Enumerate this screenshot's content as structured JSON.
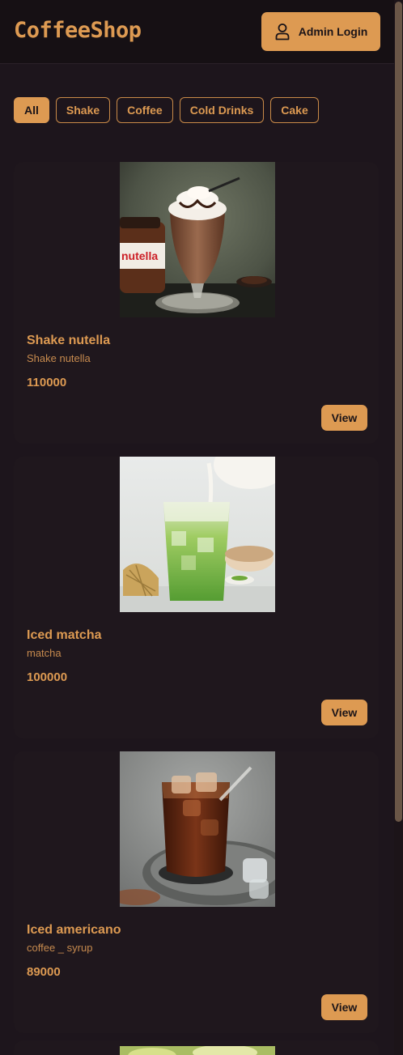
{
  "header": {
    "logo": "CoffeeShop",
    "admin_button": "Admin Login",
    "admin_icon": "user-icon"
  },
  "filters": [
    {
      "label": "All",
      "active": true
    },
    {
      "label": "Shake",
      "active": false
    },
    {
      "label": "Coffee",
      "active": false
    },
    {
      "label": "Cold Drinks",
      "active": false
    },
    {
      "label": "Cake",
      "active": false
    }
  ],
  "products": [
    {
      "name": "Shake nutella",
      "description": "Shake nutella",
      "price": "110000",
      "view_label": "View",
      "image": "nutella-shake-photo"
    },
    {
      "name": "Iced matcha",
      "description": "matcha",
      "price": "100000",
      "view_label": "View",
      "image": "iced-matcha-photo"
    },
    {
      "name": "Iced americano",
      "description": "coffee _ syrup",
      "price": "89000",
      "view_label": "View",
      "image": "iced-americano-photo"
    }
  ],
  "colors": {
    "accent": "#dd9a52",
    "background": "#1d151c",
    "card": "#1f171d",
    "header": "#161014"
  }
}
